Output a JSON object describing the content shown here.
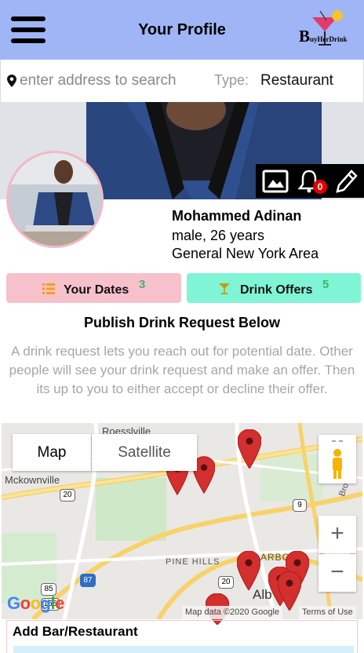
{
  "header": {
    "title": "Your Profile",
    "logo_letters": {
      "big": "B",
      "small": "uyHerDrink"
    },
    "background_color": "#9fb5f5"
  },
  "search": {
    "placeholder": "enter address to search",
    "type_label": "Type:",
    "type_value": "Restaurant"
  },
  "profile": {
    "name": "Mohammed Adinan",
    "gender_age": "male, 26 years",
    "area": "General New York Area",
    "notification_count": "0",
    "action_icons": [
      "image-icon",
      "bell-icon",
      "pencil-icon"
    ]
  },
  "tabs": [
    {
      "label": "Your Dates",
      "count": "3",
      "icon": "list-icon",
      "color": "#f7c1cc"
    },
    {
      "label": "Drink Offers",
      "count": "5",
      "icon": "cocktail-icon",
      "color": "#7ff5d6"
    }
  ],
  "publish": {
    "title": "Publish Drink Request Below",
    "description": "A drink request lets you reach out for potential date. Other people will see your drink request and make an offer. Then its up to you to either accept or decline their offer."
  },
  "map": {
    "type_options": [
      "Map",
      "Satellite"
    ],
    "selected_type": "Map",
    "zoom_in": "+",
    "zoom_out": "−",
    "labels": {
      "top": "Roesslville",
      "left": "Mckownville",
      "pine_hills": "PINE HILLS",
      "harbor": "ARBO",
      "albany": "Alb",
      "broadway": "Bro"
    },
    "route_shields": [
      "20",
      "9",
      "87",
      "20",
      "85",
      "155"
    ],
    "google_logo": "Google",
    "attribution": "Map data ©2020 Google",
    "terms": "Terms of Use",
    "marker_color": "#d32f2f"
  },
  "add_bar": {
    "title": "Add Bar/Restaurant"
  }
}
